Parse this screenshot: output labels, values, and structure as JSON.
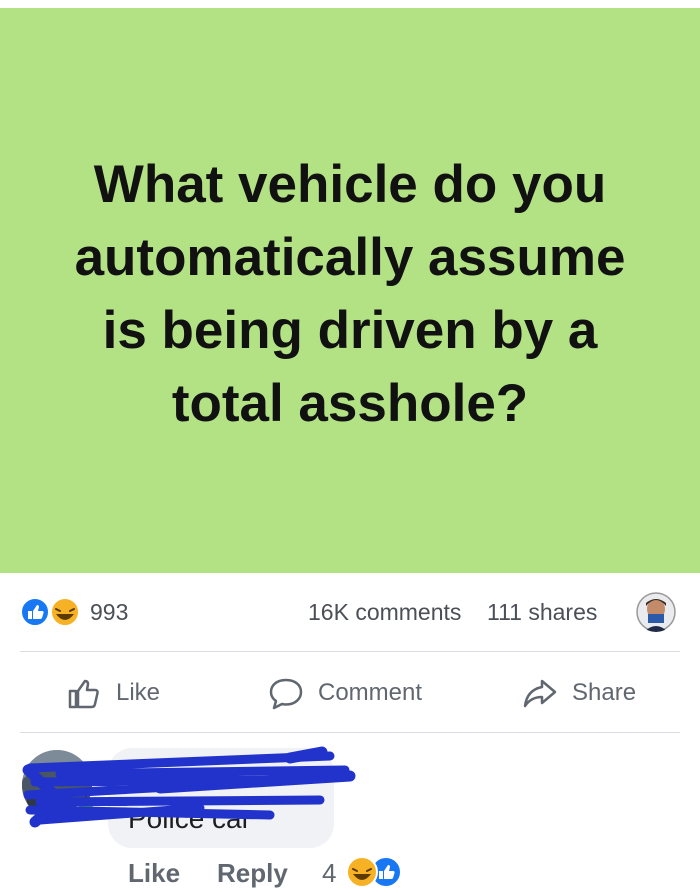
{
  "post": {
    "text": "What vehicle do you automatically assume is being driven by a total asshole?",
    "background_color": "#b3e284"
  },
  "stats": {
    "reactions": [
      "like-icon",
      "haha-icon"
    ],
    "reaction_count": "993",
    "comments": "16K comments",
    "shares": "111 shares"
  },
  "actions": {
    "like_label": "Like",
    "comment_label": "Comment",
    "share_label": "Share"
  },
  "comment": {
    "author": "",
    "text": "Police car",
    "online": true,
    "like_label": "Like",
    "reply_label": "Reply",
    "reaction_count": "4",
    "reactions": [
      "haha-icon",
      "like-icon"
    ]
  },
  "colors": {
    "accent": "#1877f2",
    "text_muted": "#606770",
    "online": "#42b72a",
    "redaction": "#2233cc"
  }
}
